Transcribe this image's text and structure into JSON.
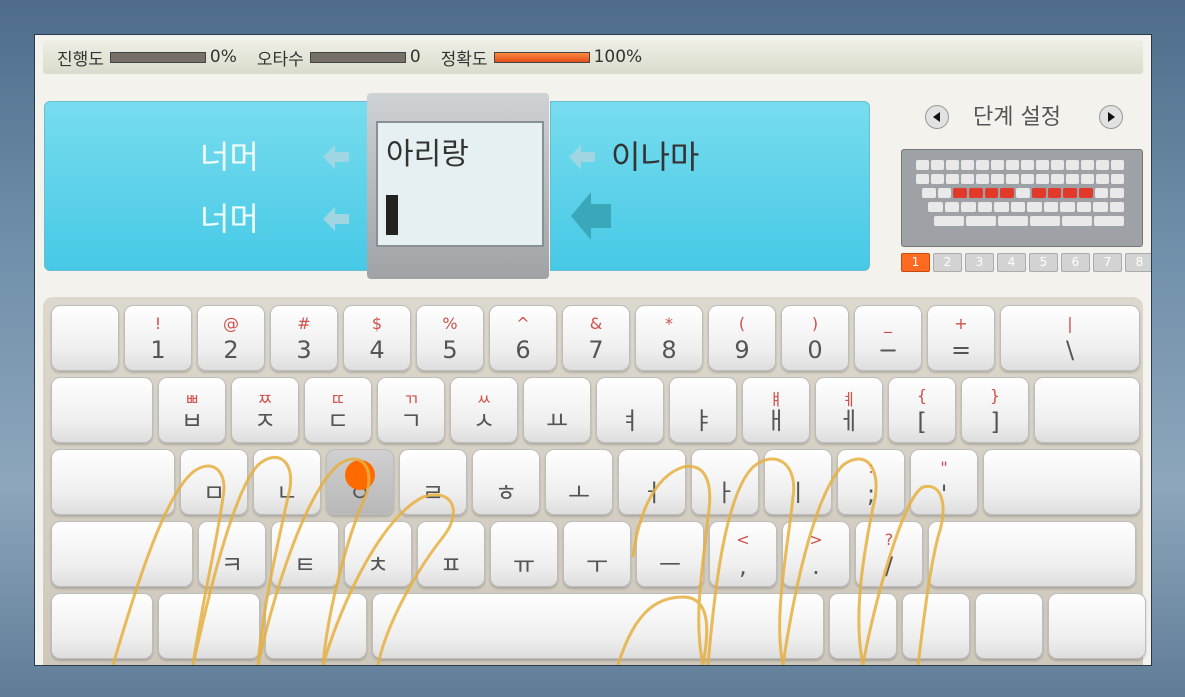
{
  "stats": {
    "progress_label": "진행도",
    "progress_value": "0%",
    "progress_fraction": 0,
    "typos_label": "오타수",
    "typos_value": "0",
    "accuracy_label": "정확도",
    "accuracy_value": "100%",
    "accuracy_fraction": 1
  },
  "words": {
    "prev_word": "너머",
    "prev_typed": "너머",
    "current_word": "아리랑",
    "next_word": "이나마"
  },
  "level": {
    "title": "단계 설정",
    "pages": [
      "1",
      "2",
      "3",
      "4",
      "5",
      "6",
      "7",
      "8"
    ],
    "active_page": "1"
  },
  "keyboard": {
    "rows": [
      [
        {
          "t": "",
          "b": ""
        },
        {
          "t": "!",
          "b": "1"
        },
        {
          "t": "@",
          "b": "2"
        },
        {
          "t": "#",
          "b": "3"
        },
        {
          "t": "$",
          "b": "4"
        },
        {
          "t": "%",
          "b": "5"
        },
        {
          "t": "^",
          "b": "6"
        },
        {
          "t": "&",
          "b": "7"
        },
        {
          "t": "*",
          "b": "8"
        },
        {
          "t": "(",
          "b": "9"
        },
        {
          "t": ")",
          "b": "0"
        },
        {
          "t": "_",
          "b": "−"
        },
        {
          "t": "+",
          "b": "="
        },
        {
          "t": "|",
          "b": "\\"
        }
      ],
      [
        {
          "t": "",
          "b": ""
        },
        {
          "t": "ㅃ",
          "b": "ㅂ"
        },
        {
          "t": "ㅉ",
          "b": "ㅈ"
        },
        {
          "t": "ㄸ",
          "b": "ㄷ"
        },
        {
          "t": "ㄲ",
          "b": "ㄱ"
        },
        {
          "t": "ㅆ",
          "b": "ㅅ"
        },
        {
          "t": "",
          "b": "ㅛ"
        },
        {
          "t": "",
          "b": "ㅕ"
        },
        {
          "t": "",
          "b": "ㅑ"
        },
        {
          "t": "ㅒ",
          "b": "ㅐ"
        },
        {
          "t": "ㅖ",
          "b": "ㅔ"
        },
        {
          "t": "{",
          "b": "["
        },
        {
          "t": "}",
          "b": "]"
        },
        {
          "t": "",
          "b": ""
        }
      ],
      [
        {
          "t": "",
          "b": ""
        },
        {
          "t": "",
          "b": "ㅁ"
        },
        {
          "t": "",
          "b": "ㄴ"
        },
        {
          "t": "",
          "b": "ㅇ"
        },
        {
          "t": "",
          "b": "ㄹ"
        },
        {
          "t": "",
          "b": "ㅎ"
        },
        {
          "t": "",
          "b": "ㅗ"
        },
        {
          "t": "",
          "b": "ㅓ"
        },
        {
          "t": "",
          "b": "ㅏ"
        },
        {
          "t": "",
          "b": "ㅣ"
        },
        {
          "t": ":",
          "b": ";"
        },
        {
          "t": "\"",
          "b": "'"
        },
        {
          "t": "",
          "b": ""
        }
      ],
      [
        {
          "t": "",
          "b": ""
        },
        {
          "t": "",
          "b": "ㅋ"
        },
        {
          "t": "",
          "b": "ㅌ"
        },
        {
          "t": "",
          "b": "ㅊ"
        },
        {
          "t": "",
          "b": "ㅍ"
        },
        {
          "t": "",
          "b": "ㅠ"
        },
        {
          "t": "",
          "b": "ㅜ"
        },
        {
          "t": "",
          "b": "ㅡ"
        },
        {
          "t": "<",
          "b": ","
        },
        {
          "t": ">",
          "b": "."
        },
        {
          "t": "?",
          "b": "/"
        },
        {
          "t": "",
          "b": ""
        }
      ],
      [
        {
          "t": "",
          "b": ""
        },
        {
          "t": "",
          "b": ""
        },
        {
          "t": "",
          "b": ""
        },
        {
          "t": "",
          "b": ""
        },
        {
          "t": "",
          "b": ""
        },
        {
          "t": "",
          "b": ""
        },
        {
          "t": "",
          "b": ""
        },
        {
          "t": "",
          "b": ""
        }
      ]
    ],
    "highlighted_key": "ㅇ",
    "highlight_color": "#ff6a00"
  },
  "colors": {
    "panel": "#4fcbe6",
    "accent": "#ff6a22"
  }
}
